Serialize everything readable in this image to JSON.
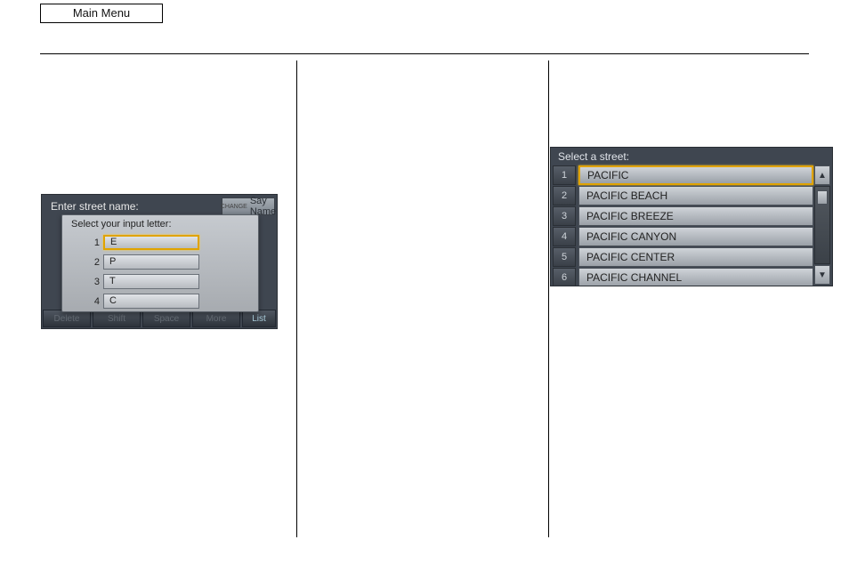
{
  "header": {
    "mainMenuLabel": "Main Menu"
  },
  "shot1": {
    "outerTitle": "Enter street name:",
    "changeMode": "CHANGE",
    "sayName": "Say Name",
    "bottom": {
      "delete": "Delete",
      "shift": "Shift",
      "space": "Space",
      "more": "More",
      "list": "List"
    },
    "overlay": {
      "title": "Select your input letter:",
      "rows": [
        {
          "n": "1",
          "v": "E"
        },
        {
          "n": "2",
          "v": "P"
        },
        {
          "n": "3",
          "v": "T"
        },
        {
          "n": "4",
          "v": "C"
        }
      ]
    }
  },
  "shot2": {
    "title": "Select a street:",
    "rows": [
      {
        "n": "1",
        "v": "PACIFIC"
      },
      {
        "n": "2",
        "v": "PACIFIC BEACH"
      },
      {
        "n": "3",
        "v": "PACIFIC BREEZE"
      },
      {
        "n": "4",
        "v": "PACIFIC CANYON"
      },
      {
        "n": "5",
        "v": "PACIFIC CENTER"
      },
      {
        "n": "6",
        "v": "PACIFIC CHANNEL"
      }
    ]
  }
}
